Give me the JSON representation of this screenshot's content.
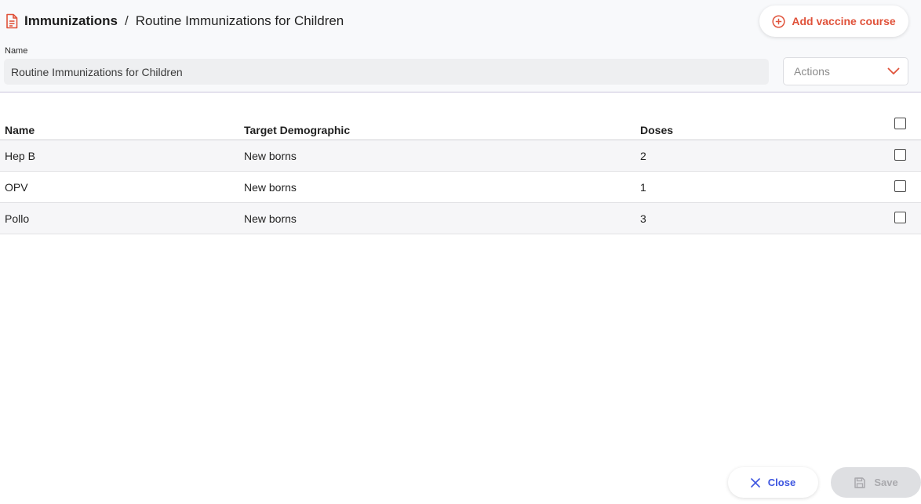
{
  "header": {
    "breadcrumb_root": "Immunizations",
    "breadcrumb_separator": "/",
    "breadcrumb_current": "Routine Immunizations for Children",
    "add_button_label": "Add vaccine course",
    "icons": {
      "document": "document-icon",
      "add": "plus-circle-icon"
    }
  },
  "form": {
    "name_label": "Name",
    "name_value": "Routine Immunizations for Children",
    "actions_placeholder": "Actions"
  },
  "table": {
    "columns": [
      "Name",
      "Target Demographic",
      "Doses"
    ],
    "rows": [
      {
        "name": "Hep B",
        "demographic": "New borns",
        "doses": "2"
      },
      {
        "name": "OPV",
        "demographic": "New borns",
        "doses": "1"
      },
      {
        "name": "Pollo",
        "demographic": "New borns",
        "doses": "3"
      }
    ]
  },
  "footer": {
    "close_label": "Close",
    "save_label": "Save"
  },
  "colors": {
    "accent": "#e0523a",
    "close_blue": "#3d55e0",
    "disabled": "#dedfe2"
  }
}
